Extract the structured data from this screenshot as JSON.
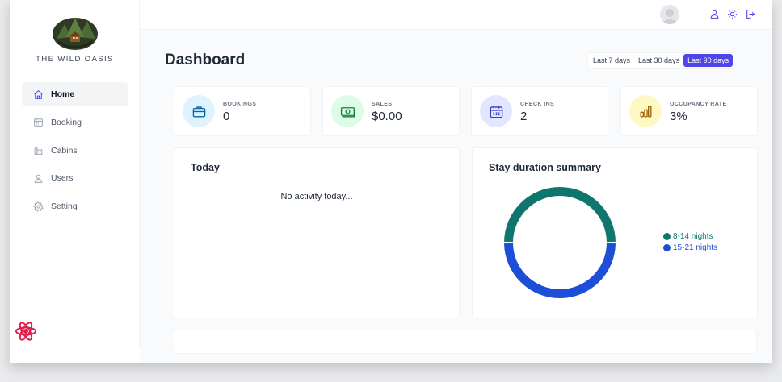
{
  "brand": {
    "name": "THE WILD OASIS"
  },
  "sidebar": {
    "items": [
      {
        "label": "Home",
        "icon": "home-icon",
        "active": true
      },
      {
        "label": "Booking",
        "icon": "calendar-icon",
        "active": false
      },
      {
        "label": "Cabins",
        "icon": "cabin-icon",
        "active": false
      },
      {
        "label": "Users",
        "icon": "user-icon",
        "active": false
      },
      {
        "label": "Setting",
        "icon": "gear-icon",
        "active": false
      }
    ]
  },
  "header": {
    "icons": [
      "avatar",
      "user-icon",
      "sun-icon",
      "logout-icon"
    ],
    "accent": "#4f46e5"
  },
  "main": {
    "title": "Dashboard",
    "filters": [
      {
        "label": "Last 7 days",
        "active": false
      },
      {
        "label": "Last 30 days",
        "active": false
      },
      {
        "label": "Last 90 days",
        "active": true
      }
    ],
    "stats": [
      {
        "label": "BOOKINGS",
        "value": "0",
        "icon": "briefcase-icon",
        "bg": "#e0f2fe",
        "color": "#0369a1"
      },
      {
        "label": "SALES",
        "value": "$0.00",
        "icon": "banknotes-icon",
        "bg": "#dcfce7",
        "color": "#15803d"
      },
      {
        "label": "CHECK INS",
        "value": "2",
        "icon": "calendar-days-icon",
        "bg": "#e0e7ff",
        "color": "#4338ca"
      },
      {
        "label": "OCCUPANCY RATE",
        "value": "3%",
        "icon": "chart-bar-icon",
        "bg": "#fef9c3",
        "color": "#a16207"
      }
    ],
    "today": {
      "title": "Today",
      "empty_message": "No activity today..."
    },
    "duration": {
      "title": "Stay duration summary",
      "chart_data": {
        "type": "pie",
        "categories": [
          "8-14 nights",
          "15-21 nights"
        ],
        "values": [
          1,
          1
        ],
        "colors": [
          "#0f766e",
          "#1d4ed8"
        ],
        "legend": "right"
      }
    }
  }
}
